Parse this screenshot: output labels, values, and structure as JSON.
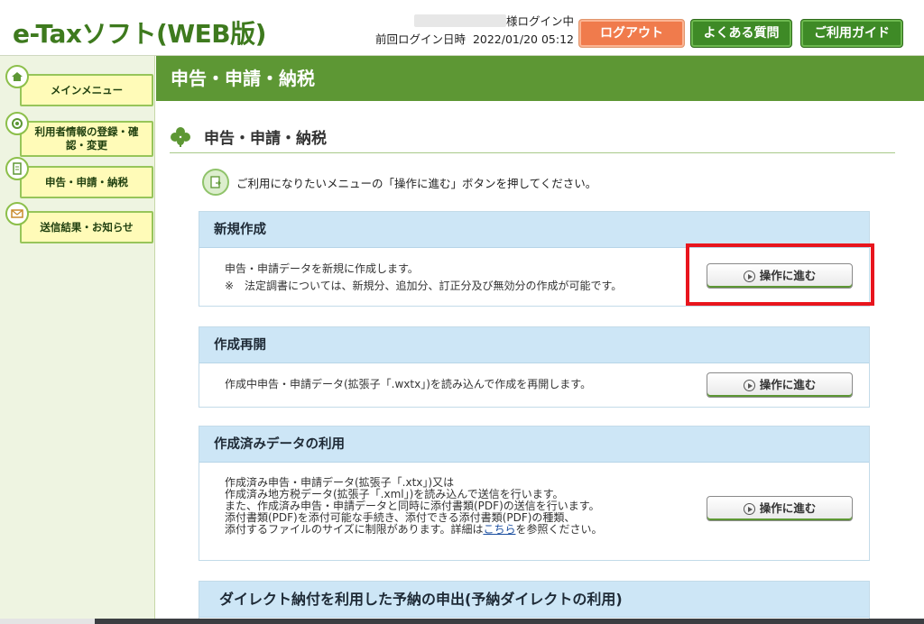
{
  "header": {
    "logo": "e-Taxソフト(WEB版)",
    "user_suffix": "様ログイン中",
    "last_login_label": "前回ログイン日時",
    "last_login_value": "2022/01/20 05:12",
    "logout_label": "ログアウト",
    "faq_label": "よくある質問",
    "guide_label": "ご利用ガイド"
  },
  "sidebar": {
    "items": [
      {
        "label": "メインメニュー",
        "icon": "home-icon"
      },
      {
        "label": "利用者情報の登録・確認・変更",
        "icon": "user-settings-icon"
      },
      {
        "label": "申告・申請・納税",
        "icon": "document-icon"
      },
      {
        "label": "送信結果・お知らせ",
        "icon": "mail-icon"
      }
    ]
  },
  "main": {
    "bar_title": "申告・申請・納税",
    "section_title": "申告・申請・納税",
    "instruction": "ご利用になりたいメニューの「操作に進む」ボタンを押してください。",
    "panels": [
      {
        "title": "新規作成",
        "lines": [
          "申告・申請データを新規に作成します。",
          "※　法定調書については、新規分、追加分、訂正分及び無効分の作成が可能です。"
        ],
        "button": "操作に進む"
      },
      {
        "title": "作成再開",
        "lines": [
          "作成中申告・申請データ(拡張子「.wxtx」)を読み込んで作成を再開します。"
        ],
        "button": "操作に進む"
      },
      {
        "title": "作成済みデータの利用",
        "lines": [
          "作成済み申告・申請データ(拡張子「.xtx」)又は",
          "作成済み地方税データ(拡張子「.xml」)を読み込んで送信を行います。",
          "また、作成済み申告・申請データと同時に添付書類(PDF)の送信を行います。",
          "添付書類(PDF)を添付可能な手続き、添付できる添付書類(PDF)の種類、"
        ],
        "line5_prefix": "添付するファイルのサイズに制限があります。詳細は",
        "line5_link": "こちら",
        "line5_suffix": "を参照ください。",
        "button": "操作に進む"
      },
      {
        "title": "ダイレクト納付を利用した予納の申出(予納ダイレクトの利用)"
      }
    ]
  },
  "colors": {
    "brand_green": "#5d9734",
    "logout_orange": "#f07b4c",
    "highlight_red": "#e8151d",
    "panel_head_blue": "#cde6f6"
  }
}
